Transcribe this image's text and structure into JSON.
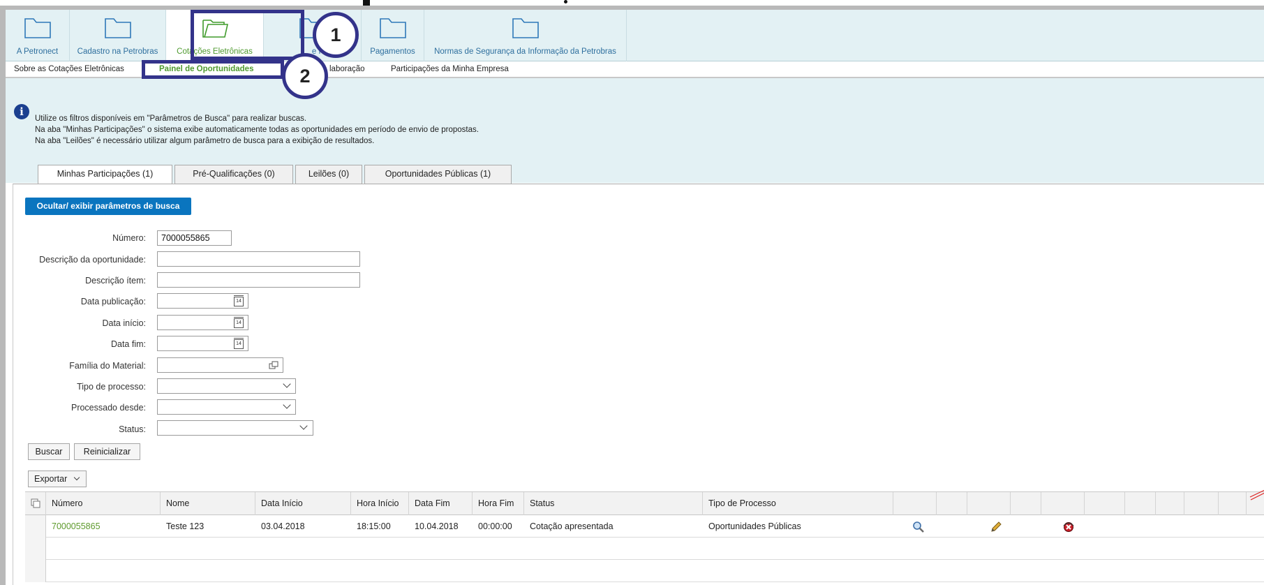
{
  "topnav": {
    "items": [
      {
        "label": "A Petronect",
        "active": false
      },
      {
        "label": "Cadastro na Petrobras",
        "active": false
      },
      {
        "label": "Cotações Eletrônicas",
        "active": true
      },
      {
        "label": "e Pedidos",
        "active": false
      },
      {
        "label": "Pagamentos",
        "active": false
      },
      {
        "label": "Normas de Segurança da Informação da Petrobras",
        "active": false
      }
    ]
  },
  "subnav": {
    "items": [
      {
        "label": "Sobre as Cotações Eletrônicas",
        "active": false
      },
      {
        "label": "Painel de Oportunidades",
        "active": true
      },
      {
        "label": "laboração",
        "active": false
      },
      {
        "label": "Participações da Minha Empresa",
        "active": false
      }
    ]
  },
  "info": {
    "icon": "info-icon",
    "lines": [
      "Utilize os filtros disponíveis em \"Parâmetros de Busca\" para realizar buscas.",
      "Na aba \"Minhas Participações\" o sistema exibe automaticamente todas as oportunidades em período de envio de propostas.",
      "Na aba \"Leilões\" é necessário utilizar algum parâmetro de busca para a exibição de resultados."
    ]
  },
  "tabs": [
    {
      "label": "Minhas Participações (1)",
      "active": true
    },
    {
      "label": "Pré-Qualificações (0)",
      "active": false
    },
    {
      "label": "Leilões (0)",
      "active": false
    },
    {
      "label": "Oportunidades Públicas (1)",
      "active": false
    }
  ],
  "search": {
    "toggle_button": "Ocultar/ exibir parâmetros de busca",
    "fields": {
      "numero_label": "Número:",
      "numero_value": "7000055865",
      "descricao_oportunidade_label": "Descrição da oportunidade:",
      "descricao_oportunidade_value": "",
      "descricao_item_label": "Descrição ítem:",
      "descricao_item_value": "",
      "data_publicacao_label": "Data publicação:",
      "data_inicio_label": "Data início:",
      "data_fim_label": "Data fim:",
      "familia_label": "Família do Material:",
      "tipo_processo_label": "Tipo de processo:",
      "processado_desde_label": "Processado desde:",
      "status_label": "Status:",
      "calendar_icon_text": "14"
    },
    "buscar_button": "Buscar",
    "reinicializar_button": "Reinicializar",
    "exportar_button": "Exportar"
  },
  "table": {
    "columns": [
      "Número",
      "Nome",
      "Data Início",
      "Hora Início",
      "Data Fim",
      "Hora Fim",
      "Status",
      "Tipo de Processo"
    ],
    "rows": [
      {
        "numero": "7000055865",
        "nome": "Teste 123",
        "data_inicio": "03.04.2018",
        "hora_inicio": "18:15:00",
        "data_fim": "10.04.2018",
        "hora_fim": "00:00:00",
        "status": "Cotação apresentada",
        "tipo_processo": "Oportunidades Públicas",
        "actions": [
          "magnifier-icon",
          "pencil-icon",
          "delete-icon"
        ]
      }
    ]
  },
  "annotations": {
    "step1": "1",
    "step2": "2",
    "color": "#33338a"
  },
  "colors": {
    "nav_bg": "#e3f1f4",
    "link_blue": "#2e6f9e",
    "active_green": "#4f9a2f",
    "button_blue": "#0a75bf"
  }
}
